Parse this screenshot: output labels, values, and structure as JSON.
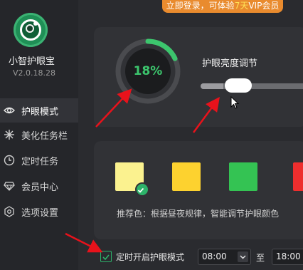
{
  "app": {
    "name": "小智护眼宝",
    "version": "V2.0.18.28"
  },
  "banner": {
    "prefix": "立即登录，可体验",
    "days": "7天",
    "suffix": "VIP会员"
  },
  "sidebar": {
    "items": [
      {
        "label": "护眼模式",
        "icon": "eye-icon",
        "active": true
      },
      {
        "label": "美化任务栏",
        "icon": "sparkle-icon",
        "active": false
      },
      {
        "label": "定时任务",
        "icon": "clock-icon",
        "active": false
      },
      {
        "label": "会员中心",
        "icon": "diamond-icon",
        "active": false
      },
      {
        "label": "选项设置",
        "icon": "gear-icon",
        "active": false
      }
    ]
  },
  "brightness": {
    "gauge_text": "18%",
    "gauge_value": 0.18,
    "title": "护眼亮度调节",
    "slider_value": 0.2,
    "accent": "#3cc56d"
  },
  "colors": {
    "swatches": [
      {
        "color": "#fbf28f",
        "selected": true
      },
      {
        "color": "#fdd22f",
        "selected": false
      },
      {
        "color": "#34c353",
        "selected": false
      },
      {
        "color": "#ee2e2e",
        "selected": false
      }
    ],
    "recommend_text": "推荐色：根据昼夜规律，智能调节护眼颜色"
  },
  "timer": {
    "label": "定时开启护眼模式",
    "checked": true,
    "start": "08:00",
    "to": "至",
    "end": "18:00"
  },
  "annotation_color": "#e8121b"
}
